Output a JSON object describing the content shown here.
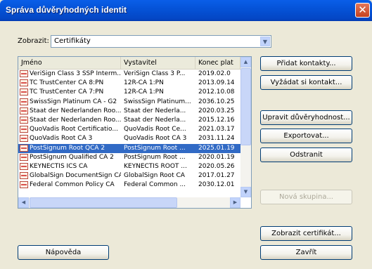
{
  "window": {
    "title": "Správa důvěryhodných identit",
    "close_glyph": "✕"
  },
  "filter": {
    "label": "Zobrazit:",
    "value": "Certifikáty"
  },
  "list": {
    "columns": [
      "Jméno",
      "Vystavitel",
      "Konec plat"
    ],
    "rows": [
      {
        "name": "VeriSign Class 3 SSP Interm...",
        "issuer": "VeriSign Class 3 P...",
        "expires": "2019.02.0",
        "selected": false
      },
      {
        "name": "TC TrustCenter CA 8:PN",
        "issuer": "12R-CA 1:PN",
        "expires": "2013.09.14",
        "selected": false
      },
      {
        "name": "TC TrustCenter CA 7:PN",
        "issuer": "12R-CA 1:PN",
        "expires": "2012.10.08",
        "selected": false
      },
      {
        "name": "SwissSign Platinum CA - G2",
        "issuer": "SwissSign Platinum...",
        "expires": "2036.10.25",
        "selected": false
      },
      {
        "name": "Staat der Nederlanden Roo...",
        "issuer": "Staat der Nederla...",
        "expires": "2020.03.25",
        "selected": false
      },
      {
        "name": "Staat der Nederlanden Roo...",
        "issuer": "Staat der Nederla...",
        "expires": "2015.12.16",
        "selected": false
      },
      {
        "name": "QuoVadis Root Certificatio...",
        "issuer": "QuoVadis Root Ce...",
        "expires": "2021.03.17",
        "selected": false
      },
      {
        "name": "QuoVadis Root CA 3",
        "issuer": "QuoVadis Root CA 3",
        "expires": "2031.11.24",
        "selected": false
      },
      {
        "name": "PostSignum Root QCA 2",
        "issuer": "PostSignum Root ...",
        "expires": "2025.01.19",
        "selected": true
      },
      {
        "name": "PostSignum Qualified CA 2",
        "issuer": "PostSignum Root ...",
        "expires": "2020.01.19",
        "selected": false
      },
      {
        "name": "KEYNECTIS ICS CA",
        "issuer": "KEYNECTIS ROOT ...",
        "expires": "2020.05.26",
        "selected": false
      },
      {
        "name": "GlobalSign DocumentSign CA",
        "issuer": "GlobalSign Root CA",
        "expires": "2017.01.27",
        "selected": false
      },
      {
        "name": "Federal Common Policy CA",
        "issuer": "Federal Common ...",
        "expires": "2030.12.01",
        "selected": false
      }
    ]
  },
  "buttons": {
    "add_contacts": "Přidat kontakty...",
    "request_contact": "Vyžádat si kontakt...",
    "edit_trust": "Upravit důvěryhodnost...",
    "export": "Exportovat...",
    "remove": "Odstranit",
    "new_group": "Nová skupina...",
    "show_certificate": "Zobrazit certifikát...",
    "help": "Nápověda",
    "close": "Zavřít"
  }
}
